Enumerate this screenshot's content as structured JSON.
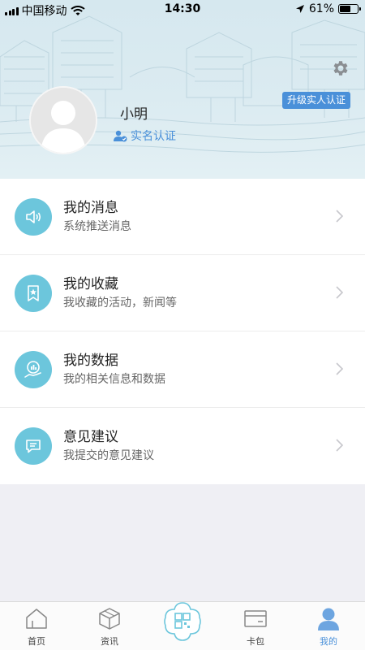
{
  "status_bar": {
    "carrier": "中国移动",
    "time": "14:30",
    "battery": "61%",
    "battery_level": 0.61
  },
  "profile": {
    "username": "小明",
    "realname_label": "实名认证",
    "upgrade_button": "升级实人认证"
  },
  "menu": [
    {
      "title": "我的消息",
      "subtitle": "系统推送消息",
      "icon": "speaker-icon"
    },
    {
      "title": "我的收藏",
      "subtitle": "我收藏的活动，新闻等",
      "icon": "bookmark-star-icon"
    },
    {
      "title": "我的数据",
      "subtitle": "我的相关信息和数据",
      "icon": "data-hand-icon"
    },
    {
      "title": "意见建议",
      "subtitle": "我提交的意见建议",
      "icon": "chat-bubble-icon"
    }
  ],
  "tabs": [
    {
      "label": "首页",
      "icon": "home-icon"
    },
    {
      "label": "资讯",
      "icon": "cube-icon"
    },
    {
      "label": "",
      "icon": "qr-scan-icon"
    },
    {
      "label": "卡包",
      "icon": "card-icon"
    },
    {
      "label": "我的",
      "icon": "person-icon",
      "active": true
    }
  ],
  "colors": {
    "accent": "#4a90d9",
    "icon_bg": "#6cc6dc",
    "header_bg": "#d6e8ef"
  }
}
